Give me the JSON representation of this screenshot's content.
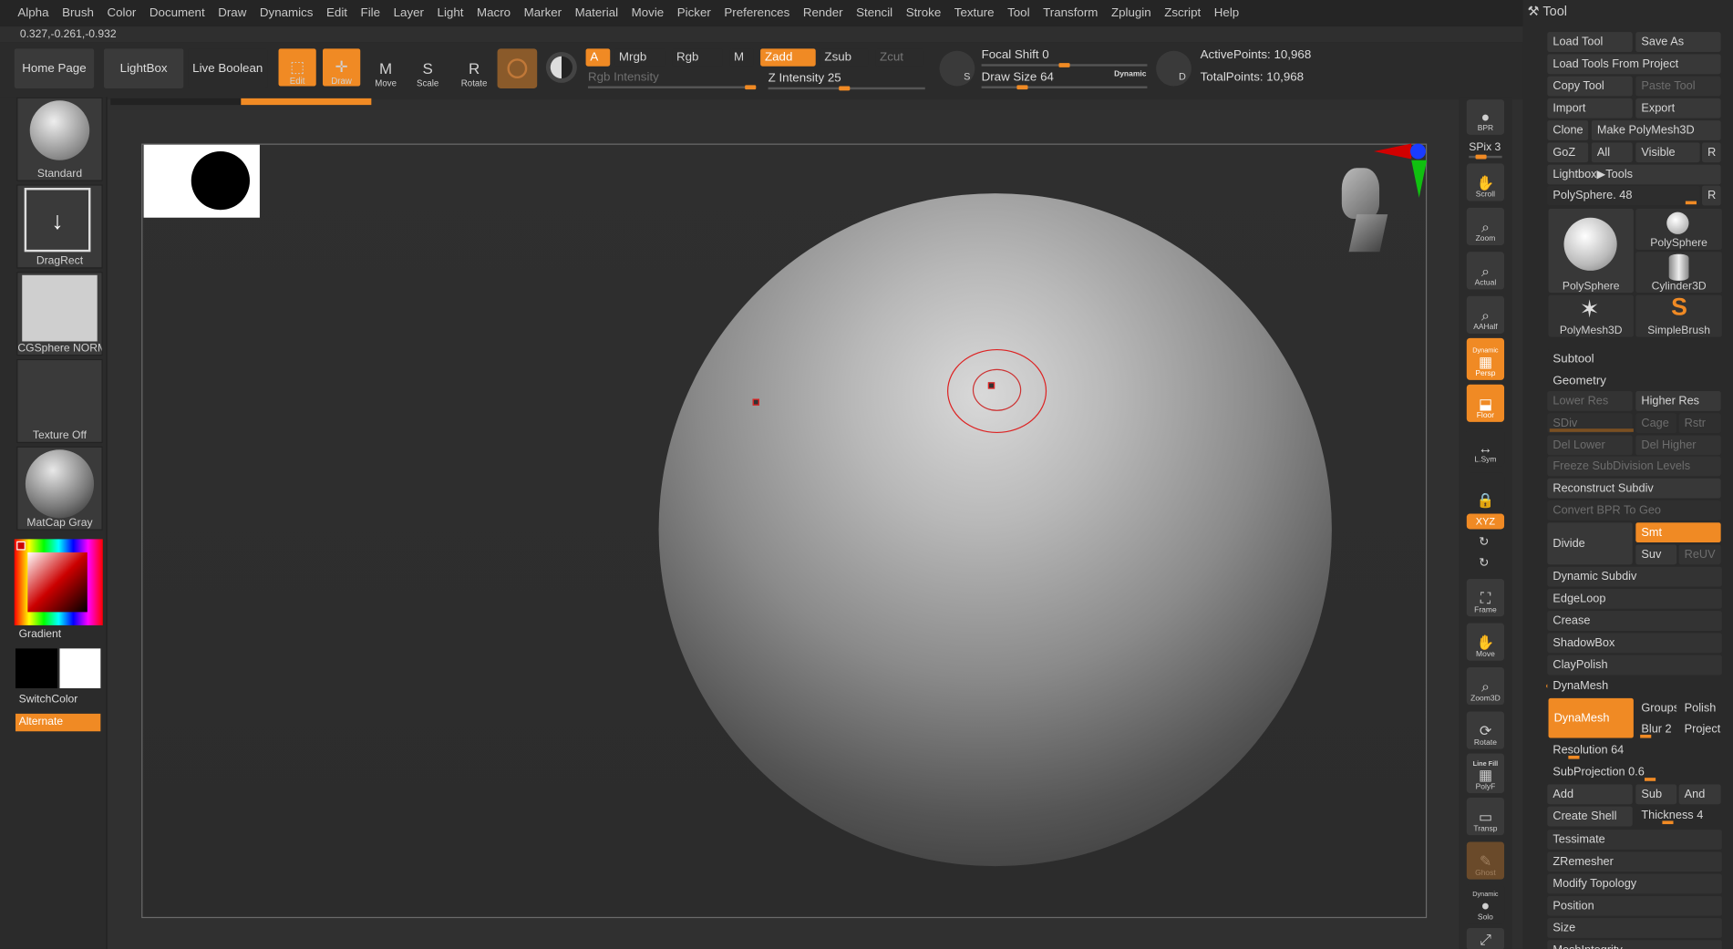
{
  "menu": [
    "Alpha",
    "Brush",
    "Color",
    "Document",
    "Draw",
    "Dynamics",
    "Edit",
    "File",
    "Layer",
    "Light",
    "Macro",
    "Marker",
    "Material",
    "Movie",
    "Picker",
    "Preferences",
    "Render",
    "Stencil",
    "Stroke",
    "Texture",
    "Tool",
    "Transform",
    "Zplugin",
    "Zscript",
    "Help"
  ],
  "coords": "0.327,-0.261,-0.932",
  "toolbar": {
    "home": "Home Page",
    "lightbox": "LightBox",
    "live_boolean": "Live Boolean",
    "edit": "Edit",
    "draw": "Draw",
    "move": "Move",
    "scale": "Scale",
    "rotate": "Rotate",
    "a": "A",
    "mrgb": "Mrgb",
    "rgb": "Rgb",
    "m": "M",
    "zadd": "Zadd",
    "zsub": "Zsub",
    "zcut": "Zcut",
    "rgb_intensity": "Rgb Intensity",
    "z_intensity_label": "Z Intensity",
    "z_intensity": "25",
    "focal_label": "Focal Shift",
    "focal": "0",
    "draw_size_label": "Draw Size",
    "draw_size": "64",
    "dynamic": "Dynamic",
    "s_label": "S",
    "d_label": "D",
    "active_points_label": "ActivePoints:",
    "active_points": "10,968",
    "total_points_label": "TotalPoints:",
    "total_points": "10,968"
  },
  "left": {
    "standard": "Standard",
    "dragrect": "DragRect",
    "cgsphere": "CGSphere NORM",
    "texture": "Texture Off",
    "matcap": "MatCap Gray",
    "gradient": "Gradient",
    "switchcolor": "SwitchColor",
    "alternate": "Alternate"
  },
  "right": {
    "bpr": "BPR",
    "spix_label": "SPix",
    "spix": "3",
    "scroll": "Scroll",
    "zoom": "Zoom",
    "actual": "Actual",
    "aahalf": "AAHalf",
    "dynamic": "Dynamic",
    "persp": "Persp",
    "floor": "Floor",
    "lsym": "L.Sym",
    "xyz": "XYZ",
    "frame": "Frame",
    "move": "Move",
    "zoom3d": "Zoom3D",
    "rotate": "Rotate",
    "linefill": "Line Fill",
    "polyf": "PolyF",
    "transp": "Transp",
    "ghost": "Ghost",
    "solo": "Solo"
  },
  "tool": {
    "title": "Tool",
    "load": "Load Tool",
    "saveas": "Save As",
    "load_project": "Load Tools From Project",
    "copy": "Copy Tool",
    "paste": "Paste Tool",
    "import": "Import",
    "export": "Export",
    "clone": "Clone",
    "make": "Make PolyMesh3D",
    "goz": "GoZ",
    "all": "All",
    "visible": "Visible",
    "r": "R",
    "lightbox_tools": "Lightbox▶Tools",
    "polysphere_slider": "PolySphere. 48",
    "thumbs": [
      "PolySphere",
      "PolySphere",
      "Cylinder3D",
      "PolyMesh3D",
      "SimpleBrush"
    ],
    "subtool": "Subtool",
    "geometry": "Geometry",
    "lower": "Lower Res",
    "higher": "Higher Res",
    "sdiv": "SDiv",
    "cage": "Cage",
    "rstr": "Rstr",
    "del_lower": "Del Lower",
    "del_higher": "Del Higher",
    "freeze": "Freeze SubDivision Levels",
    "reconstruct": "Reconstruct Subdiv",
    "convert": "Convert BPR To Geo",
    "divide": "Divide",
    "smt": "Smt",
    "suv": "Suv",
    "reuv": "ReUV",
    "dynamic_subdiv": "Dynamic Subdiv",
    "edgeloop": "EdgeLoop",
    "crease": "Crease",
    "shadowbox": "ShadowBox",
    "claypolish": "ClayPolish",
    "dynamesh_header": "DynaMesh",
    "dynamesh_btn": "DynaMesh",
    "groups": "Groups",
    "polish": "Polish",
    "blur": "Blur 2",
    "project": "Project",
    "resolution": "Resolution 64",
    "subprojection": "SubProjection 0.6",
    "add": "Add",
    "sub": "Sub",
    "and": "And",
    "create_shell": "Create Shell",
    "thickness": "Thickness 4",
    "tessimate": "Tessimate",
    "zremesher": "ZRemesher",
    "modify_topology": "Modify Topology",
    "position": "Position",
    "size": "Size",
    "meshintegrity": "MeshIntegrity"
  }
}
